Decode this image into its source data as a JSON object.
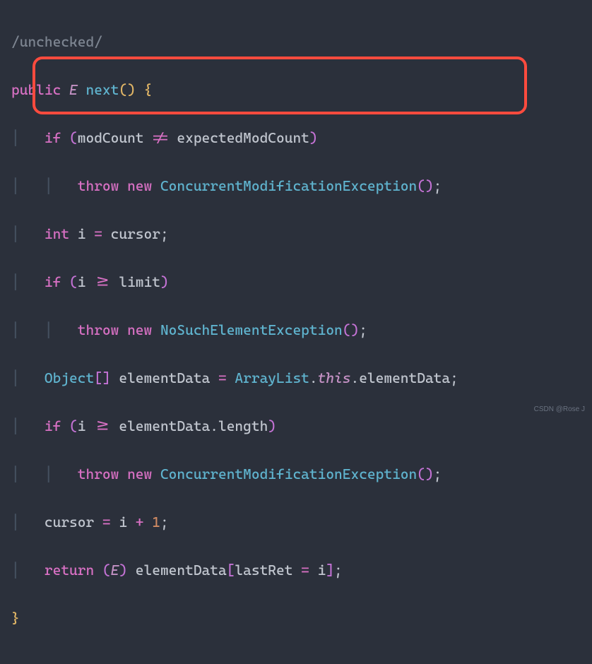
{
  "code": {
    "comment": "/unchecked/",
    "kw_public": "public",
    "ret_type": "E",
    "method_name": "next",
    "parens": "()",
    "brace_open": "{",
    "kw_if1": "if",
    "cond1_l": "(modCount ",
    "neq": "!=",
    "cond1_r": " expectedModCount)",
    "kw_throw": "throw",
    "kw_new": "new",
    "ex1": "ConcurrentModificationException",
    "call_parens": "()",
    "semi": ";",
    "int_kw": "int",
    "i_decl": " i ",
    "eq": "=",
    "cursor": " cursor",
    "kw_if2": "if",
    "cond2": "(i >= limit)",
    "ex2": "NoSuchElementException",
    "obj": "Object",
    "brackets": "[]",
    "elemdata": " elementData ",
    "arraylist": "ArrayList",
    "dot": ".",
    "this": "this",
    "elemdata2": ".elementData",
    "cond3": "(i >= elementData.length)",
    "cursor_assign_l": "cursor ",
    "cursor_assign_r": " i ",
    "plus": "+",
    "one": "1",
    "kw_return": "return",
    "cast_open": "(",
    "cast_type": "E",
    "cast_close": ")",
    "ret_expr_l": " elementData",
    "bracket_open": "[",
    "lastret": "lastRet ",
    "ret_expr_r": " i",
    "bracket_close": "]",
    "brace_close": "}"
  },
  "watermark": "CSDN @Rose J"
}
